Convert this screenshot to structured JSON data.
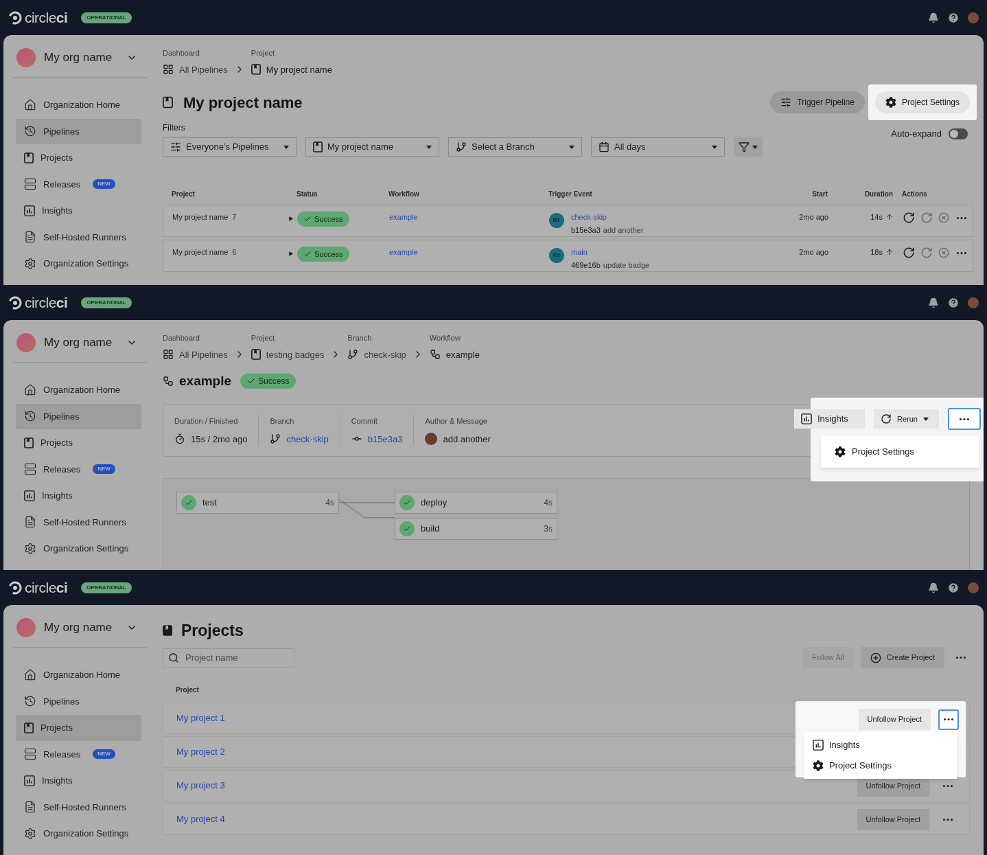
{
  "panels": [
    {
      "kind": "pipelines",
      "topbar": {
        "logo": "circle**ci**",
        "status": "OPERATIONAL"
      },
      "sidebar": {
        "org": "My org name",
        "items": [
          {
            "kind": "home",
            "label": "Organization Home",
            "selected": false
          },
          {
            "kind": "pipelines",
            "label": "Pipelines",
            "selected": true
          },
          {
            "kind": "projects",
            "label": "Projects",
            "selected": false
          },
          {
            "kind": "releases",
            "label": "Releases",
            "badge": "NEW",
            "selected": false
          },
          {
            "kind": "insights",
            "label": "Insights",
            "selected": false
          },
          {
            "kind": "runners",
            "label": "Self-Hosted Runners",
            "selected": false
          },
          {
            "kind": "settings",
            "label": "Organization Settings",
            "selected": false
          }
        ]
      },
      "breadcrumbs": [
        {
          "kind": "dashboard",
          "caption": "Dashboard",
          "label": "All Pipelines",
          "current": false
        },
        {
          "kind": "project",
          "caption": "Project",
          "label": "My project name",
          "current": true
        }
      ],
      "title": "My project name",
      "buttons": [
        {
          "kind": "trigger",
          "label": "Trigger Pipeline",
          "highlighted": false
        },
        {
          "kind": "settings",
          "label": "Project Settings",
          "highlighted": true
        }
      ],
      "filters_label": "Filters",
      "filters": [
        {
          "kind": "pipelines",
          "label": "Everyone’s Pipelines"
        },
        {
          "kind": "project",
          "label": "My project name"
        },
        {
          "kind": "branch",
          "label": "Select a Branch"
        },
        {
          "kind": "calendar",
          "label": "All days"
        }
      ],
      "auto_expand": {
        "label": "Auto-expand",
        "on": false
      },
      "table": {
        "columns": [
          "Project",
          "Status",
          "Workflow",
          "Trigger Event",
          "Start",
          "Duration",
          "Actions"
        ],
        "rows": [
          {
            "project": "My project name",
            "number": "7",
            "status": "Success",
            "workflow": "example",
            "initials": "RY",
            "branch": "check-skip",
            "commit": "b15e3a3",
            "message": "add another",
            "start": "2mo ago",
            "duration": "14s"
          },
          {
            "project": "My project name",
            "number": "6",
            "status": "Success",
            "workflow": "example",
            "initials": "RY",
            "branch": "main",
            "commit": "469e16b",
            "message": "update badge",
            "start": "2mo ago",
            "duration": "18s"
          }
        ]
      }
    },
    {
      "kind": "workflow",
      "topbar": {
        "logo": "circle**ci**",
        "status": "OPERATIONAL"
      },
      "sidebar": {
        "org": "My org name",
        "items": [
          {
            "kind": "home",
            "label": "Organization Home",
            "selected": false
          },
          {
            "kind": "pipelines",
            "label": "Pipelines",
            "selected": true
          },
          {
            "kind": "projects",
            "label": "Projects",
            "selected": false
          },
          {
            "kind": "releases",
            "label": "Releases",
            "badge": "NEW",
            "selected": false
          },
          {
            "kind": "insights",
            "label": "Insights",
            "selected": false
          },
          {
            "kind": "runners",
            "label": "Self-Hosted Runners",
            "selected": false
          },
          {
            "kind": "settings",
            "label": "Organization Settings",
            "selected": false
          }
        ]
      },
      "breadcrumbs": [
        {
          "kind": "dashboard",
          "caption": "Dashboard",
          "label": "All Pipelines",
          "current": false
        },
        {
          "kind": "project",
          "caption": "Project",
          "label": "testing badges",
          "current": false
        },
        {
          "kind": "branch",
          "caption": "Branch",
          "label": "check-skip",
          "current": false
        },
        {
          "kind": "workflow",
          "caption": "Workflow",
          "label": "example",
          "current": true
        }
      ],
      "title": "example",
      "status": "Success",
      "buttons": [
        {
          "kind": "insights",
          "label": "Insights"
        },
        {
          "kind": "rerun",
          "label": "Rerun"
        }
      ],
      "more": {
        "open": true
      },
      "menu": [
        {
          "kind": "settings",
          "label": "Project Settings"
        }
      ],
      "summary": [
        {
          "kind": "timer",
          "caption": "Duration / Finished",
          "value": "15s / 2mo ago",
          "link": false
        },
        {
          "kind": "branch",
          "caption": "Branch",
          "value": "check-skip",
          "link": true
        },
        {
          "kind": "commit",
          "caption": "Commit",
          "value": "b15e3a3",
          "link": true
        },
        {
          "kind": "author",
          "caption": "Author & Message",
          "value": "add another",
          "link": false
        }
      ],
      "jobs": [
        {
          "name": "test",
          "duration": "4s",
          "children": [
            {
              "name": "deploy",
              "duration": "4s"
            },
            {
              "name": "build",
              "duration": "3s"
            }
          ]
        }
      ]
    },
    {
      "kind": "projects",
      "topbar": {
        "logo": "circle**ci**",
        "status": "OPERATIONAL"
      },
      "sidebar": {
        "org": "My org name",
        "items": [
          {
            "kind": "home",
            "label": "Organization Home",
            "selected": false
          },
          {
            "kind": "pipelines",
            "label": "Pipelines",
            "selected": false
          },
          {
            "kind": "projects",
            "label": "Projects",
            "selected": true
          },
          {
            "kind": "releases",
            "label": "Releases",
            "badge": "NEW",
            "selected": false
          },
          {
            "kind": "insights",
            "label": "Insights",
            "selected": false
          },
          {
            "kind": "runners",
            "label": "Self-Hosted Runners",
            "selected": false
          },
          {
            "kind": "settings",
            "label": "Organization Settings",
            "selected": false
          }
        ]
      },
      "title": "Projects",
      "search": {
        "placeholder": "Project name"
      },
      "buttons": [
        {
          "kind": "follow",
          "label": "Follow All",
          "disabled": true
        },
        {
          "kind": "create",
          "label": "Create Project",
          "disabled": false
        }
      ],
      "column": "Project",
      "menu": [
        {
          "kind": "insights",
          "label": "Insights"
        },
        {
          "kind": "settings",
          "label": "Project Settings"
        }
      ],
      "rows": [
        {
          "name": "My project 1",
          "action": "Unfollow Project",
          "menu_open": true
        },
        {
          "name": "My project 2",
          "menu_open": false
        },
        {
          "name": "My project 3",
          "action": "Unfollow Project",
          "menu_open": false
        },
        {
          "name": "My project 4",
          "action": "Unfollow Project",
          "menu_open": false
        }
      ]
    }
  ]
}
